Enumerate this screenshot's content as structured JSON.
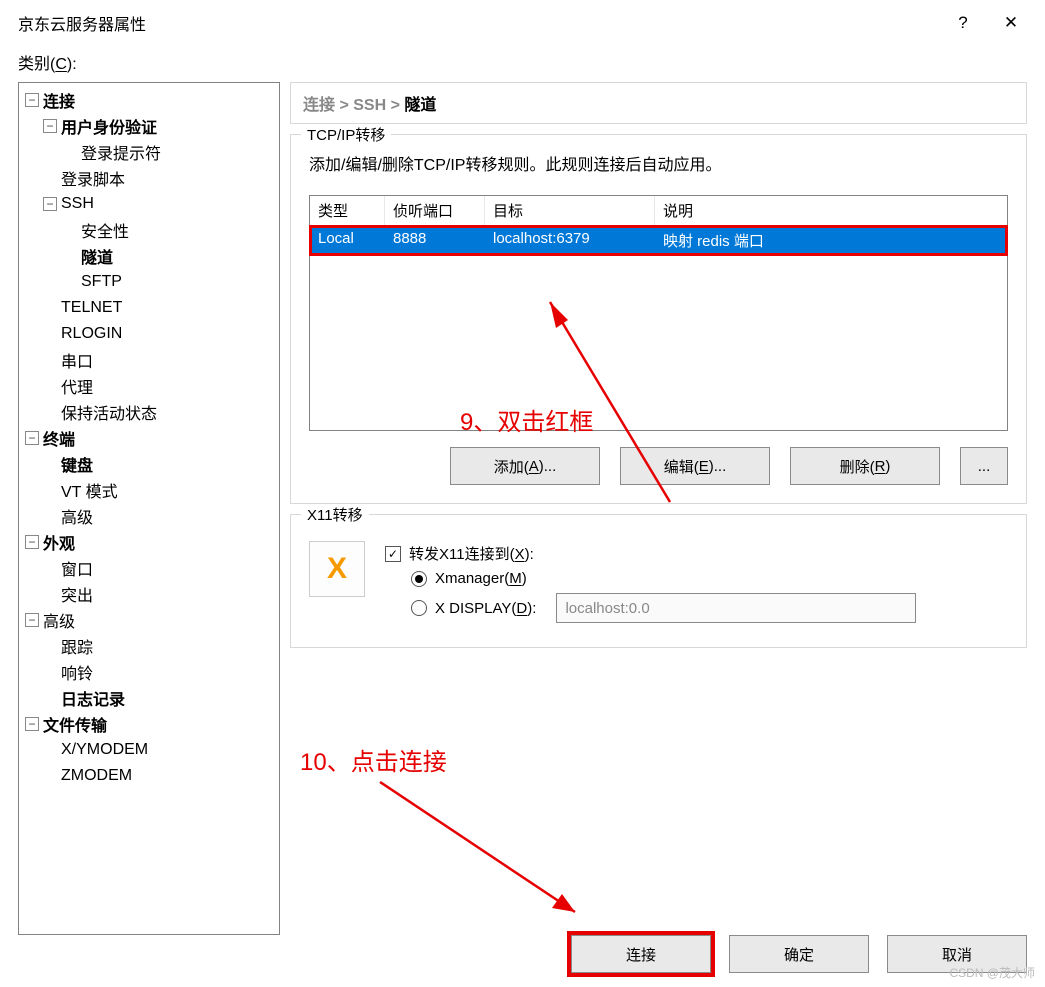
{
  "titlebar": {
    "title": "京东云服务器属性"
  },
  "category_label": "类别(",
  "category_key": "C",
  "category_close": "):",
  "tree": {
    "connection": "连接",
    "user_auth": "用户身份验证",
    "login_prompt": "登录提示符",
    "login_script": "登录脚本",
    "ssh": "SSH",
    "security": "安全性",
    "tunnel": "隧道",
    "sftp": "SFTP",
    "telnet": "TELNET",
    "rlogin": "RLOGIN",
    "serial": "串口",
    "proxy": "代理",
    "keep_alive": "保持活动状态",
    "terminal": "终端",
    "keyboard": "键盘",
    "vt_mode": "VT 模式",
    "advanced_term": "高级",
    "appearance": "外观",
    "window": "窗口",
    "popup": "突出",
    "advanced": "高级",
    "trace": "跟踪",
    "bell": "响铃",
    "logging": "日志记录",
    "file_transfer": "文件传输",
    "xymodem": "X/YMODEM",
    "zmodem": "ZMODEM"
  },
  "breadcrumb": {
    "a": "连接",
    "sep": " > ",
    "b": "SSH",
    "c": "隧道"
  },
  "tcp": {
    "title": "TCP/IP转移",
    "desc": "添加/编辑/删除TCP/IP转移规则。此规则连接后自动应用。",
    "head": {
      "type": "类型",
      "port": "侦听端口",
      "target": "目标",
      "desc": "说明"
    },
    "row": {
      "type": "Local",
      "port": "8888",
      "target": "localhost:6379",
      "desc": "映射 redis 端口"
    },
    "btn_add_pre": "添加(",
    "btn_add_key": "A",
    "btn_add_suf": ")...",
    "btn_edit_pre": "编辑(",
    "btn_edit_key": "E",
    "btn_edit_suf": ")...",
    "btn_del_pre": "删除(",
    "btn_del_key": "R",
    "btn_del_suf": ")",
    "btn_more": "..."
  },
  "x11": {
    "title": "X11转移",
    "forward_pre": "转发X11连接到(",
    "forward_key": "X",
    "forward_suf": "):",
    "xmanager_pre": "Xmanager(",
    "xmanager_key": "M",
    "xmanager_suf": ")",
    "xdisplay_pre": "X DISPLAY(",
    "xdisplay_key": "D",
    "xdisplay_suf": "):",
    "xdisplay_value": "localhost:0.0"
  },
  "footer": {
    "connect": "连接",
    "ok": "确定",
    "cancel": "取消"
  },
  "annotations": {
    "a9": "9、双击红框",
    "a10": "10、点击连接"
  },
  "watermark": "CSDN @茂大师"
}
